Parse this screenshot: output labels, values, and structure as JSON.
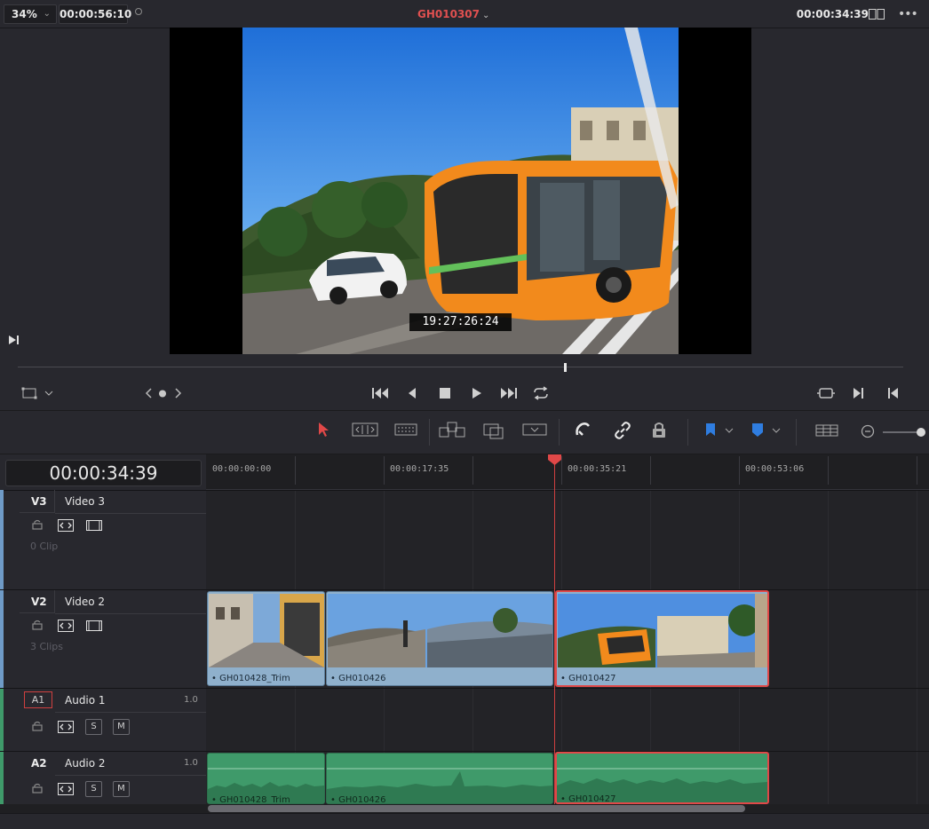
{
  "topbar": {
    "zoom": "34%",
    "source_timecode": "00:00:56:10",
    "clip_name": "GH010307",
    "record_timecode": "00:00:34:39"
  },
  "viewer": {
    "burn_in_timecode": "19:27:26:24",
    "playhead_position": 0.617
  },
  "timeline": {
    "current_timecode": "00:00:34:39",
    "ruler_labels": [
      "00:00:00:00",
      "00:00:17:35",
      "00:00:35:21",
      "00:00:53:06"
    ],
    "tracks": {
      "v3": {
        "id": "V3",
        "name": "Video 3",
        "count": "0 Clip"
      },
      "v2": {
        "id": "V2",
        "name": "Video 2",
        "count": "3 Clips"
      },
      "a1": {
        "id": "A1",
        "name": "Audio 1",
        "volume": "1.0",
        "solo": "S",
        "mute": "M"
      },
      "a2": {
        "id": "A2",
        "name": "Audio 2",
        "volume": "1.0",
        "solo": "S",
        "mute": "M"
      }
    },
    "video_clips": [
      {
        "name": "GH010428_Trim",
        "selected": false
      },
      {
        "name": "GH010426",
        "selected": false
      },
      {
        "name": "GH010427",
        "selected": true
      }
    ],
    "audio_clips": [
      {
        "name": "GH010428_Trim",
        "selected": false
      },
      {
        "name": "GH010426",
        "selected": false
      },
      {
        "name": "GH010427",
        "selected": true
      }
    ]
  },
  "colors": {
    "accent_red": "#e05050",
    "video_clip": "#8fb0cc",
    "audio_clip": "#3f9a6a",
    "flag_blue": "#2f7de0"
  },
  "icons": [
    "crop-icon",
    "prev-edit-icon",
    "next-edit-icon",
    "go-to-start-icon",
    "step-back-icon",
    "stop-icon",
    "play-icon",
    "go-to-end-icon",
    "loop-icon",
    "match-frame-icon",
    "mark-in-icon",
    "mark-out-icon",
    "selection-tool-icon",
    "trim-tool-icon",
    "blade-tool-icon",
    "insert-clip-icon",
    "overwrite-clip-icon",
    "replace-clip-icon",
    "snapping-icon",
    "linked-selection-icon",
    "position-lock-icon",
    "flag-icon",
    "marker-icon",
    "timeline-view-icon",
    "zoom-out-icon"
  ]
}
